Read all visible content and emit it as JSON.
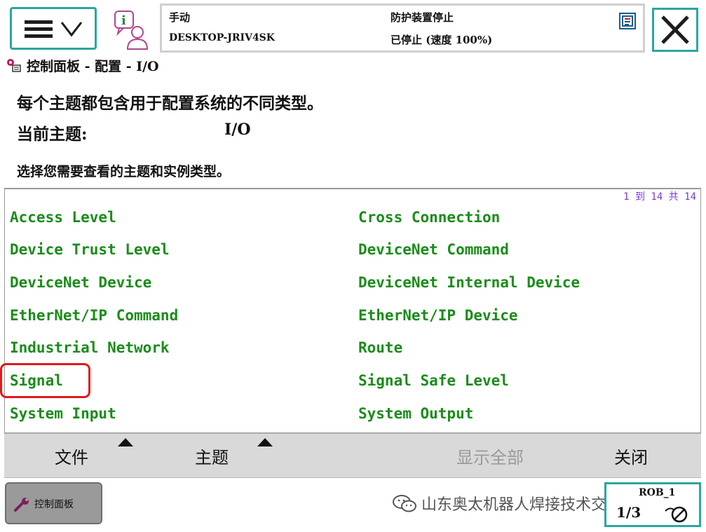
{
  "status": {
    "mode": "手动",
    "host": "DESKTOP-JRIV4SK",
    "guard": "防护装置停止",
    "state": "已停止 (速度 100%)"
  },
  "breadcrumb": "控制面板 - 配置 - I/O",
  "description": {
    "line1": "每个主题都包含用于配置系统的不同类型。",
    "current_label": "当前主题:",
    "current_value": "I/O",
    "hint": "选择您需要查看的主题和实例类型。"
  },
  "list": {
    "page_count": "1 到 14 共 14",
    "left": [
      "Access Level",
      "Device Trust Level",
      "DeviceNet Device",
      "EtherNet/IP Command",
      "Industrial Network",
      "Signal",
      "System Input"
    ],
    "right": [
      "Cross Connection",
      "DeviceNet Command",
      "DeviceNet Internal Device",
      "EtherNet/IP Device",
      "Route",
      "Signal Safe Level",
      "System Output"
    ]
  },
  "commands": {
    "file": "文件",
    "topic": "主题",
    "show_all": "显示全部",
    "close": "关闭"
  },
  "taskbar": {
    "control_panel": "控制面板",
    "rob": "ROB_1",
    "rob_speed": "1/3"
  },
  "watermark": "山东奥太机器人焊接技术交流平台",
  "colors": {
    "accent": "#2aa7a0",
    "list_text": "#1b8c1b",
    "highlight": "#e11a1a",
    "count": "#7a39d6"
  },
  "icons": {
    "menu": "hamburger-icon",
    "info": "info-user-icon",
    "close": "close-icon",
    "breadcrumb": "config-icon",
    "wrench": "wrench-icon"
  }
}
